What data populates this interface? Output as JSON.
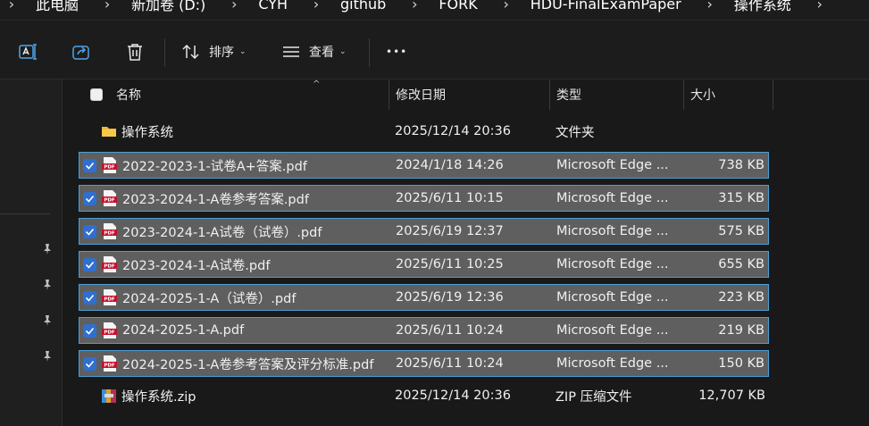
{
  "breadcrumb": [
    "此电脑",
    "新加卷 (D:)",
    "CYH",
    "github",
    "FORK",
    "HDU-FinalExamPaper",
    "操作系统"
  ],
  "toolbar": {
    "sort_label": "排序",
    "view_label": "查看",
    "more_label": "•••"
  },
  "columns": {
    "name": "名称",
    "date": "修改日期",
    "type": "类型",
    "size": "大小"
  },
  "files": [
    {
      "name": "操作系统",
      "date": "2025/12/14 20:36",
      "type": "文件夹",
      "size": "",
      "icon": "folder-icon",
      "selected": false
    },
    {
      "name": "2022-2023-1-试卷A+答案.pdf",
      "date": "2024/1/18 14:26",
      "type": "Microsoft Edge ...",
      "size": "738 KB",
      "icon": "pdf-icon",
      "selected": true
    },
    {
      "name": "2023-2024-1-A卷参考答案.pdf",
      "date": "2025/6/11 10:15",
      "type": "Microsoft Edge ...",
      "size": "315 KB",
      "icon": "pdf-icon",
      "selected": true
    },
    {
      "name": "2023-2024-1-A试卷（试卷）.pdf",
      "date": "2025/6/19 12:37",
      "type": "Microsoft Edge ...",
      "size": "575 KB",
      "icon": "pdf-icon",
      "selected": true
    },
    {
      "name": "2023-2024-1-A试卷.pdf",
      "date": "2025/6/11 10:25",
      "type": "Microsoft Edge ...",
      "size": "655 KB",
      "icon": "pdf-icon",
      "selected": true
    },
    {
      "name": "2024-2025-1-A（试卷）.pdf",
      "date": "2025/6/19 12:36",
      "type": "Microsoft Edge ...",
      "size": "223 KB",
      "icon": "pdf-icon",
      "selected": true
    },
    {
      "name": "2024-2025-1-A.pdf",
      "date": "2025/6/11 10:24",
      "type": "Microsoft Edge ...",
      "size": "219 KB",
      "icon": "pdf-icon",
      "selected": true
    },
    {
      "name": "2024-2025-1-A卷参考答案及评分标准.pdf",
      "date": "2025/6/11 10:24",
      "type": "Microsoft Edge ...",
      "size": "150 KB",
      "icon": "pdf-icon",
      "selected": true
    },
    {
      "name": "操作系统.zip",
      "date": "2025/12/14 20:36",
      "type": "ZIP 压缩文件",
      "size": "12,707 KB",
      "icon": "zip-archive-icon",
      "selected": false
    }
  ],
  "colors": {
    "selection_bg": "#5f5f5f",
    "selection_border": "#4aa0d6",
    "checkbox": "#2f6fd0",
    "folder": "#f0b93a",
    "pdf": "#c8102e"
  }
}
